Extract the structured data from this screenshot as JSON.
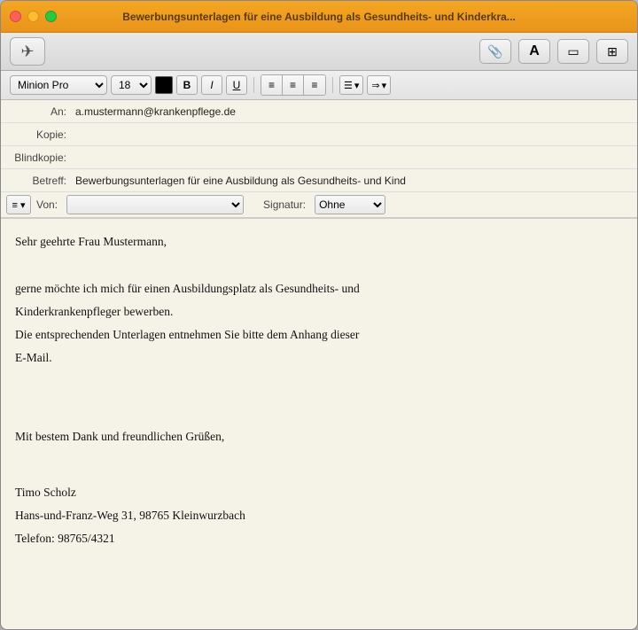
{
  "window": {
    "title": "Bewerbungsunterlagen für eine Ausbildung als Gesundheits- und Kinderkra...",
    "titleFull": "Bewerbungsunterlagen für eine Ausbildung als Gesundheits- und Kinderkrankenpfleger"
  },
  "toolbar": {
    "send_label": "✈",
    "attach_label": "📎",
    "font_label": "A",
    "window_label": "⊞",
    "grid_label": "⊟"
  },
  "formatting": {
    "font_name": "Minion Pro",
    "font_size": "18",
    "bold_label": "B",
    "italic_label": "I",
    "underline_label": "U",
    "align_left": "≡",
    "align_center": "≡",
    "align_right": "≡",
    "list_label": "☰",
    "indent_label": "⇒"
  },
  "fields": {
    "to_label": "An:",
    "to_value": "a.mustermann@krankenpflege.de",
    "cc_label": "Kopie:",
    "cc_value": "",
    "bcc_label": "Blindkopie:",
    "bcc_value": "",
    "subject_label": "Betreff:",
    "subject_value": "Bewerbungsunterlagen für eine Ausbildung als Gesundheits- und Kind",
    "from_label": "Von:",
    "from_value": "",
    "signature_label": "Signatur:",
    "signature_value": "Ohne"
  },
  "body": {
    "greeting": "Sehr geehrte Frau Mustermann,",
    "para1_line1": "gerne möchte ich mich für einen Ausbildungsplatz als Gesundheits- und",
    "para1_line2": "Kinderkrankenpfleger bewerben.",
    "para1_line3": "Die entsprechenden Unterlagen entnehmen Sie bitte dem Anhang dieser",
    "para1_line4": "E-Mail.",
    "closing": "Mit bestem Dank und freundlichen Grüßen,",
    "name": "Timo Scholz",
    "address": "Hans-und-Franz-Weg 31, 98765 Kleinwurzbach",
    "phone": "Telefon: 98765/4321"
  }
}
